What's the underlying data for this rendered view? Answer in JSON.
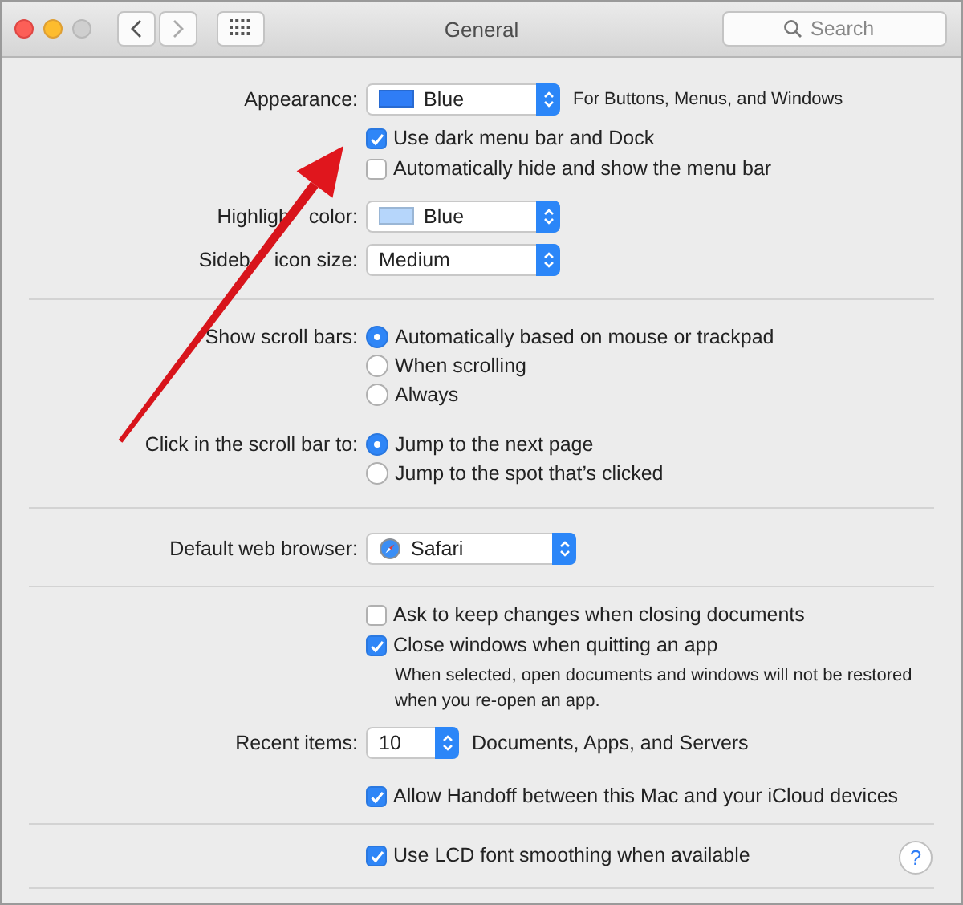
{
  "window": {
    "title": "General",
    "search": {
      "placeholder": "Search"
    }
  },
  "sections": [
    {
      "rows": [
        {
          "kind": "popup",
          "label": "Appearance:",
          "value": "Blue",
          "color": "#2f7df6",
          "note": "For Buttons, Menus, and Windows"
        },
        {
          "kind": "checkbox",
          "text": "Use dark menu bar and Dock",
          "checked": true
        },
        {
          "kind": "checkbox",
          "text": "Automatically hide and show the menu bar",
          "checked": false
        },
        {
          "kind": "popup",
          "label_parts": [
            "Highligh",
            "color:"
          ],
          "value": "Blue",
          "color": "#b6d6fb"
        },
        {
          "kind": "popup",
          "label_parts": [
            "Sideb",
            "icon size:"
          ],
          "value": "Medium"
        }
      ]
    },
    {
      "rows": [
        {
          "kind": "radio",
          "label": "Show scroll bars:",
          "options": [
            {
              "text": "Automatically based on mouse or trackpad",
              "selected": true
            },
            {
              "text": "When scrolling",
              "selected": false
            },
            {
              "text": "Always",
              "selected": false
            }
          ]
        },
        {
          "kind": "radio",
          "label": "Click in the scroll bar to:",
          "options": [
            {
              "text": "Jump to the next page",
              "selected": true
            },
            {
              "text": "Jump to the spot that’s clicked",
              "selected": false
            }
          ]
        }
      ]
    },
    {
      "rows": [
        {
          "kind": "app_popup",
          "label": "Default web browser:",
          "value": "Safari"
        }
      ]
    },
    {
      "rows": [
        {
          "kind": "checkbox",
          "text": "Ask to keep changes when closing documents",
          "checked": false
        },
        {
          "kind": "checkbox",
          "text": "Close windows when quitting an app",
          "checked": true
        },
        {
          "kind": "note",
          "text": "When selected, open documents and windows will not be restored when you re-open an app."
        },
        {
          "kind": "stepper",
          "label": "Recent items:",
          "value": "10",
          "note": "Documents, Apps, and Servers"
        },
        {
          "kind": "checkbox",
          "text": "Allow Handoff between this Mac and your iCloud devices",
          "checked": true
        }
      ]
    },
    {
      "rows": [
        {
          "kind": "checkbox",
          "text": "Use LCD font smoothing when available",
          "checked": true
        }
      ]
    }
  ],
  "help": {
    "text": "?"
  },
  "annotation": {
    "kind": "arrow"
  }
}
